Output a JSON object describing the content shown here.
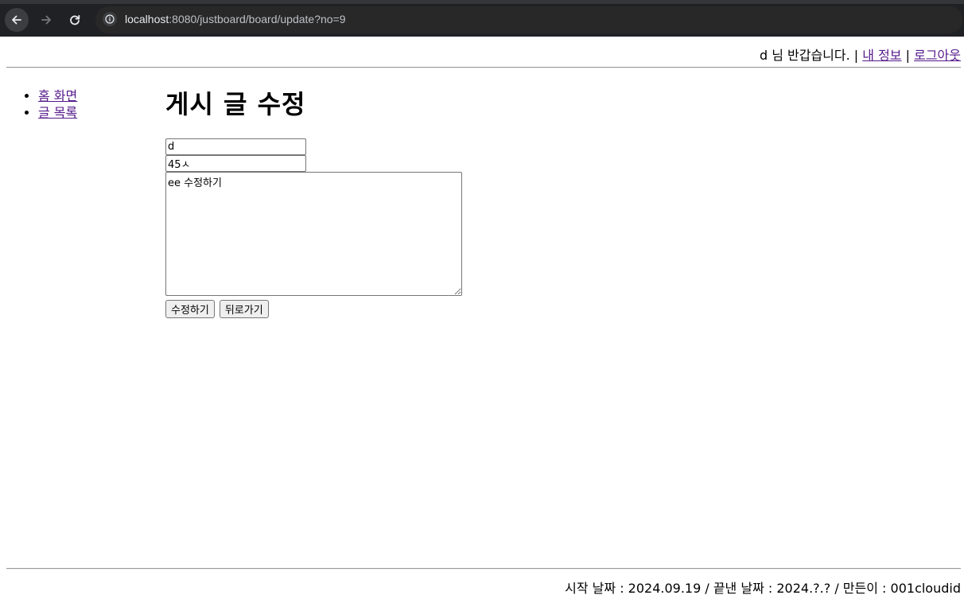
{
  "browser": {
    "url_host": "localhost",
    "url_rest": ":8080/justboard/board/update?no=9"
  },
  "header": {
    "greeting": "d 님 반갑습니다. |",
    "separator": "|",
    "my_info_link": "내 정보",
    "logout_link": "로그아웃"
  },
  "sidebar": {
    "items": [
      {
        "label": "홈 화면"
      },
      {
        "label": "글 목록"
      }
    ]
  },
  "main": {
    "title": "게시 글 수정",
    "fields": {
      "writer_value": "d",
      "title_value": "45ㅅ",
      "content_value": "ee 수정하기"
    },
    "buttons": {
      "submit_label": "수정하기",
      "back_label": "뒤로가기"
    }
  },
  "footer": {
    "text": "시작 날짜 : 2024.09.19 / 끝낸 날짜 : 2024.?.? / 만든이 : 001cloudid"
  }
}
